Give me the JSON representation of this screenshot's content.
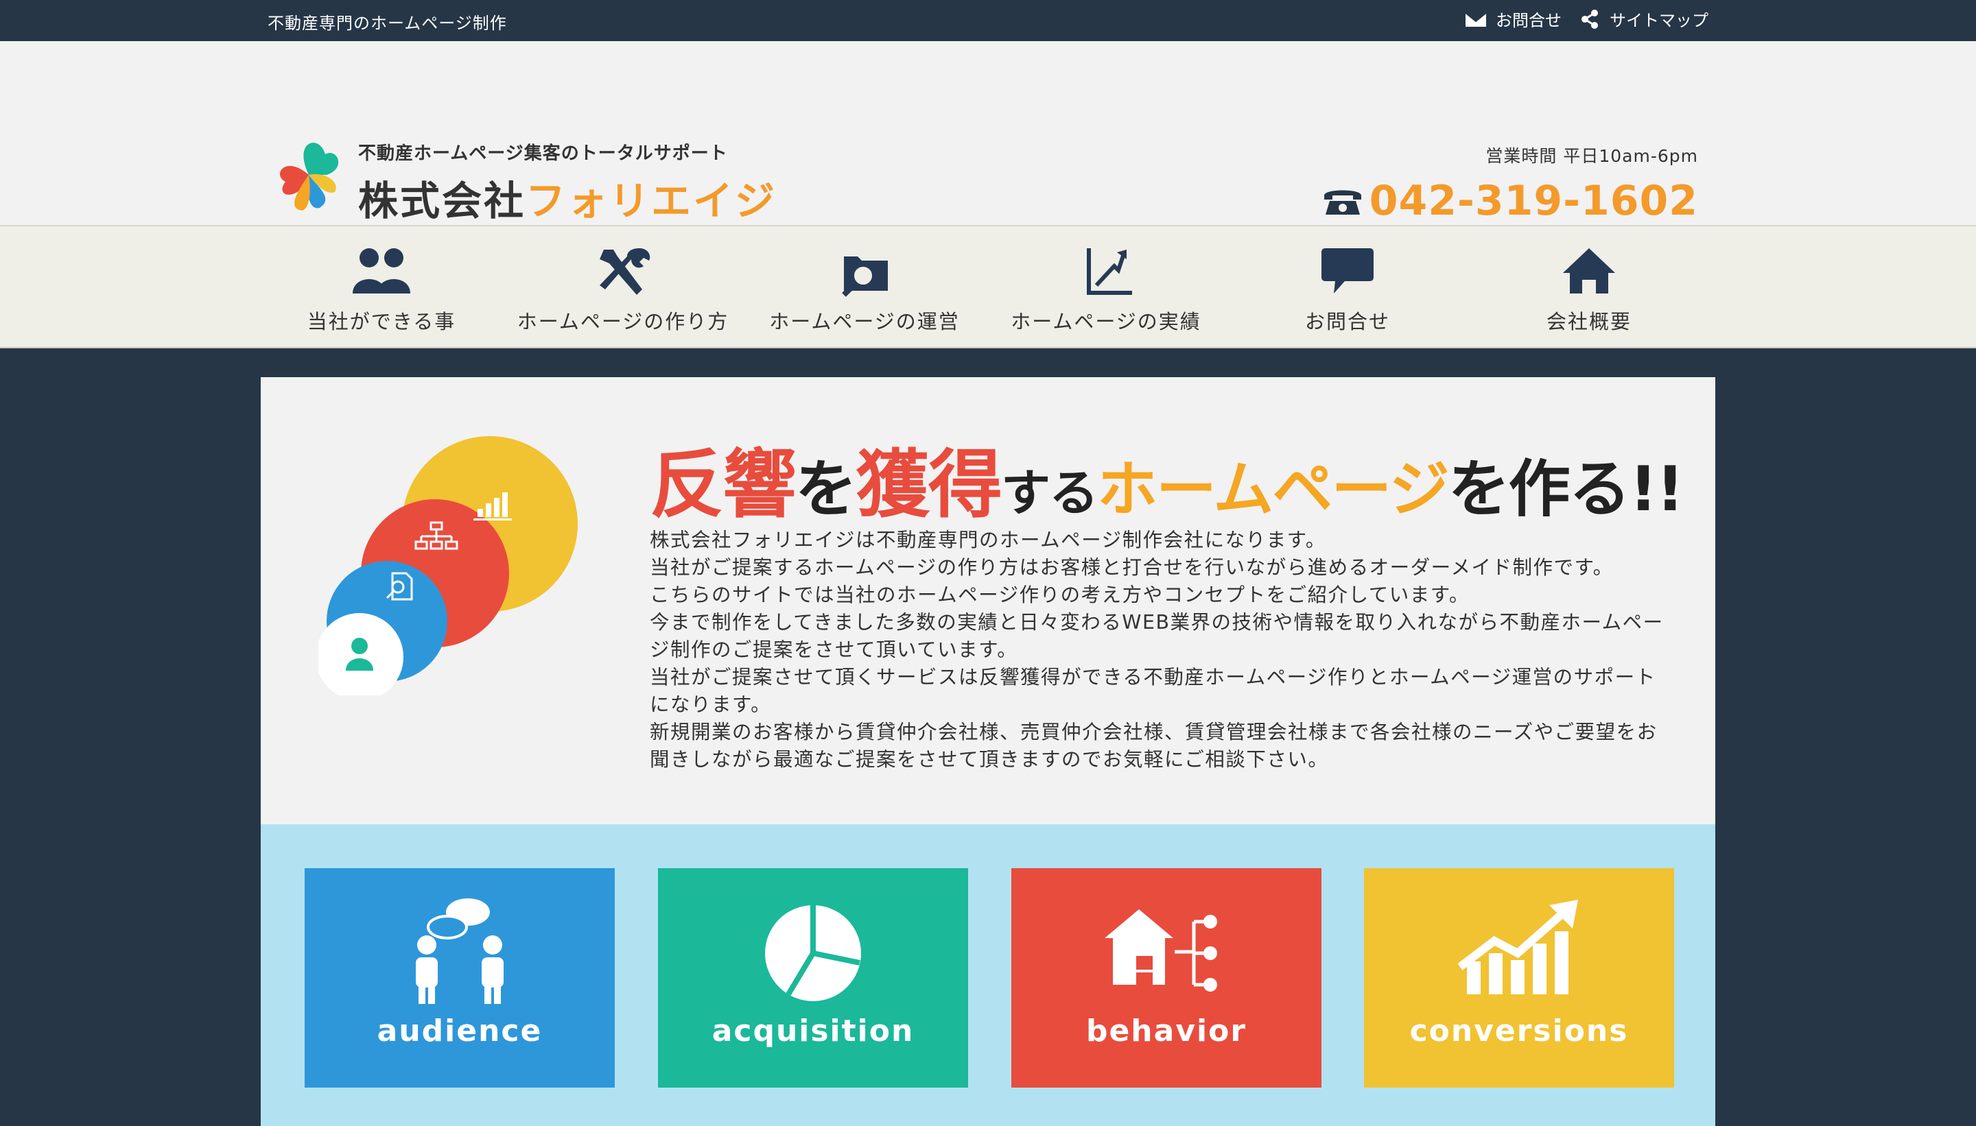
{
  "topbar": {
    "tagline": "不動産専門のホームページ制作",
    "contact_link": "お問合せ",
    "sitemap_link": "サイトマップ"
  },
  "header": {
    "logo_sub": "不動産ホームページ集客のトータルサポート",
    "logo_name_kanji": "株式会社",
    "logo_name_kana": "フォリエイジ",
    "hours": "営業時間 平日10am-6pm",
    "phone": "042-319-1602"
  },
  "nav": {
    "items": [
      {
        "label": "当社ができる事",
        "icon": "people-icon"
      },
      {
        "label": "ホームページの作り方",
        "icon": "tools-icon"
      },
      {
        "label": "ホームページの運営",
        "icon": "folder-search-icon"
      },
      {
        "label": "ホームページの実績",
        "icon": "growth-chart-icon"
      },
      {
        "label": "お問合せ",
        "icon": "speech-bubble-icon"
      },
      {
        "label": "会社概要",
        "icon": "home-icon"
      }
    ]
  },
  "intro": {
    "headline": {
      "p1": "反響",
      "p2": "を",
      "p3": "獲得",
      "p4": "する",
      "p5": "ホームページ",
      "p6": "を作る!!"
    },
    "paragraphs": [
      "株式会社フォリエイジは不動産専門のホームページ制作会社になります。",
      "当社がご提案するホームページの作り方はお客様と打合せを行いながら進めるオーダーメイド制作です。",
      "こちらのサイトでは当社のホームページ作りの考え方やコンセプトをご紹介しています。",
      "今まで制作をしてきました多数の実績と日々変わるWEB業界の技術や情報を取り入れながら不動産ホームページ制作のご提案をさせて頂いています。",
      "当社がご提案させて頂くサービスは反響獲得ができる不動産ホームページ作りとホームページ運営のサポートになります。",
      "新規開業のお客様から賃貸仲介会社様、売買仲介会社様、賃貸管理会社様まで各会社様のニーズやご要望をお聞きしながら最適なご提案をさせて頂きますのでお気軽にご相談下さい。"
    ]
  },
  "features": {
    "cards": [
      {
        "label": "audience",
        "color": "#2e97d9",
        "icon": "audience-icon"
      },
      {
        "label": "acquisition",
        "color": "#1bb89a",
        "icon": "pie-chart-icon"
      },
      {
        "label": "behavior",
        "color": "#e84c3d",
        "icon": "house-flow-icon"
      },
      {
        "label": "conversions",
        "color": "#f1c232",
        "icon": "trend-chart-icon"
      }
    ]
  },
  "colors": {
    "navy": "#263647",
    "orange": "#f39a2b",
    "red": "#e84c3d",
    "light_blue": "#b2e2f1"
  }
}
